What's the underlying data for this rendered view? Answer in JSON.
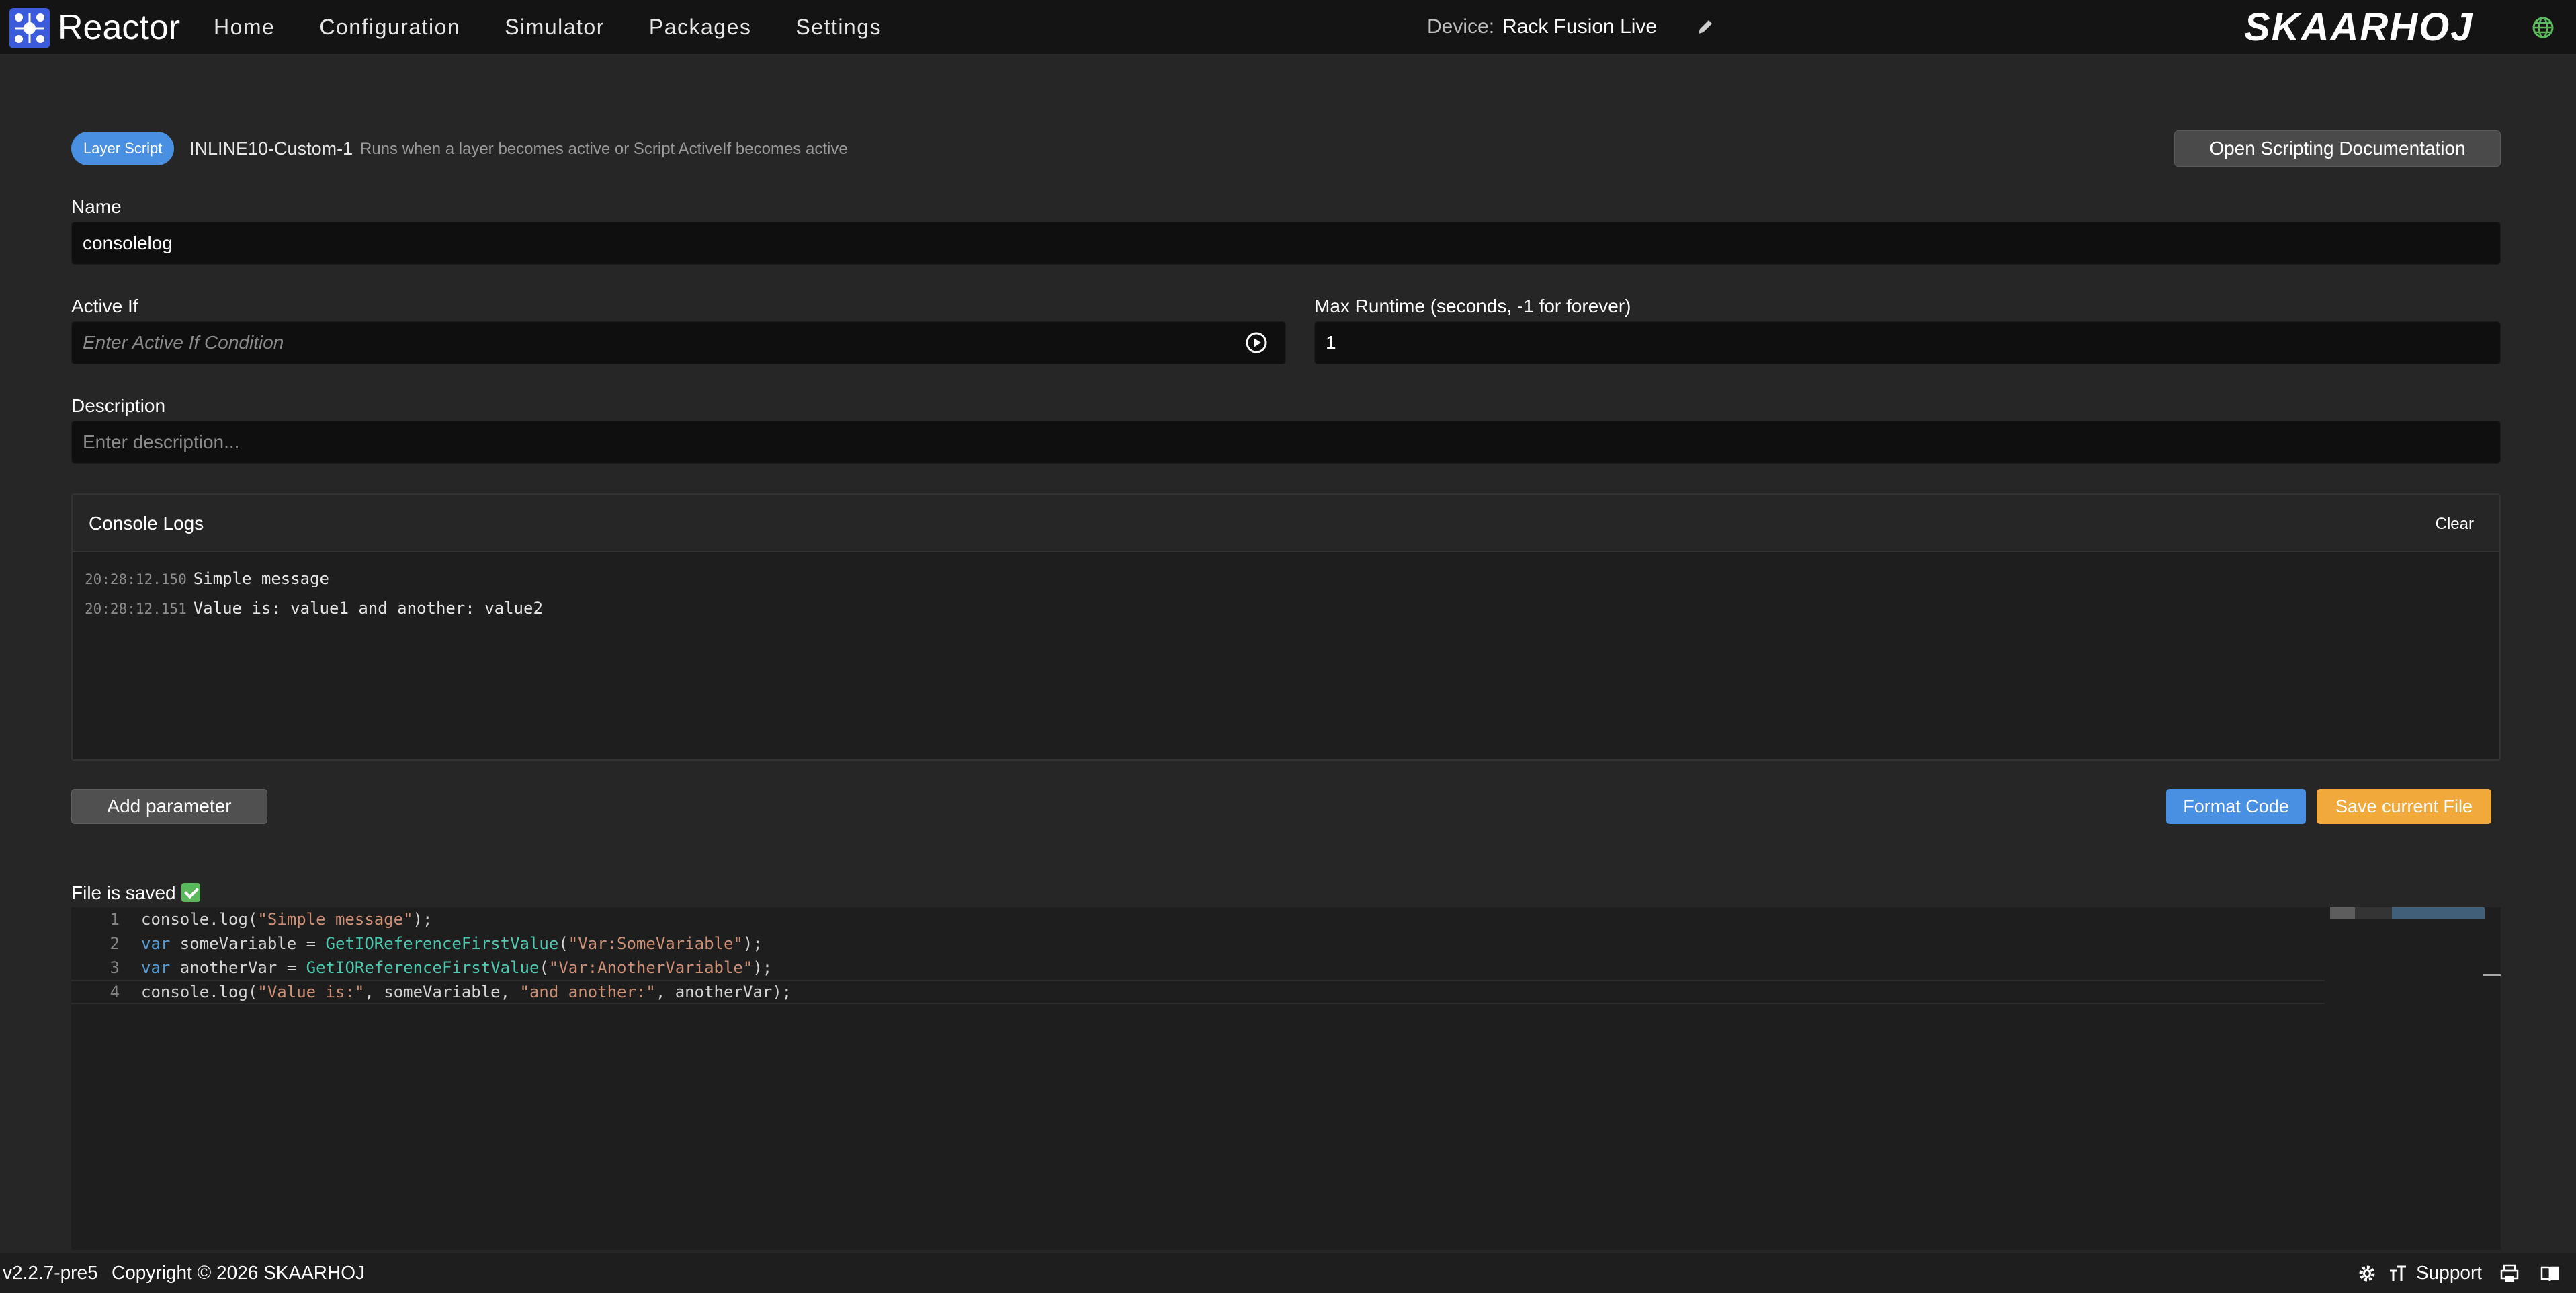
{
  "app": {
    "name": "Reactor",
    "brand": "SKAARHOJ"
  },
  "nav": {
    "items": [
      "Home",
      "Configuration",
      "Simulator",
      "Packages",
      "Settings"
    ]
  },
  "device": {
    "label": "Device:",
    "name": "Rack Fusion Live"
  },
  "script": {
    "type_badge": "Layer Script",
    "id": "INLINE10-Custom-1",
    "description": "Runs when a layer becomes active or Script ActiveIf becomes active",
    "docs_button": "Open Scripting Documentation"
  },
  "form": {
    "name_label": "Name",
    "name_value": "consolelog",
    "active_if_label": "Active If",
    "active_if_placeholder": "Enter Active If Condition",
    "max_runtime_label": "Max Runtime (seconds, -1 for forever)",
    "max_runtime_value": "1",
    "description_label": "Description",
    "description_placeholder": "Enter description..."
  },
  "console": {
    "title": "Console Logs",
    "clear_label": "Clear",
    "logs": [
      {
        "time": "20:28:12.150",
        "message": "Simple message"
      },
      {
        "time": "20:28:12.151",
        "message": "Value is: value1 and another: value2"
      }
    ]
  },
  "actions": {
    "add_parameter": "Add parameter",
    "format_code": "Format Code",
    "save_file": "Save current File"
  },
  "status": {
    "saved_text": "File is saved"
  },
  "editor": {
    "line_numbers": [
      "1",
      "2",
      "3",
      "4"
    ],
    "lines": [
      [
        {
          "t": "console.log(",
          "c": "plain"
        },
        {
          "t": "\"Simple message\"",
          "c": "str"
        },
        {
          "t": ");",
          "c": "plain"
        }
      ],
      [
        {
          "t": "var",
          "c": "kw"
        },
        {
          "t": " someVariable = ",
          "c": "plain"
        },
        {
          "t": "GetIOReferenceFirstValue",
          "c": "fn"
        },
        {
          "t": "(",
          "c": "plain"
        },
        {
          "t": "\"Var:SomeVariable\"",
          "c": "str"
        },
        {
          "t": ");",
          "c": "plain"
        }
      ],
      [
        {
          "t": "var",
          "c": "kw"
        },
        {
          "t": " anotherVar = ",
          "c": "plain"
        },
        {
          "t": "GetIOReferenceFirstValue",
          "c": "fn"
        },
        {
          "t": "(",
          "c": "plain"
        },
        {
          "t": "\"Var:AnotherVariable\"",
          "c": "str"
        },
        {
          "t": ");",
          "c": "plain"
        }
      ],
      [
        {
          "t": "console.log(",
          "c": "plain"
        },
        {
          "t": "\"Value is:\"",
          "c": "str"
        },
        {
          "t": ", someVariable, ",
          "c": "plain"
        },
        {
          "t": "\"and another:\"",
          "c": "str"
        },
        {
          "t": ", anotherVar);",
          "c": "plain"
        }
      ]
    ]
  },
  "footer": {
    "version": "v2.2.7-pre5",
    "copyright": "Copyright © 2026 SKAARHOJ",
    "support": "Support"
  },
  "colors": {
    "accent": "#4a90e2",
    "save": "#f0a93a",
    "background": "#262626",
    "input": "#0f0f0f"
  }
}
